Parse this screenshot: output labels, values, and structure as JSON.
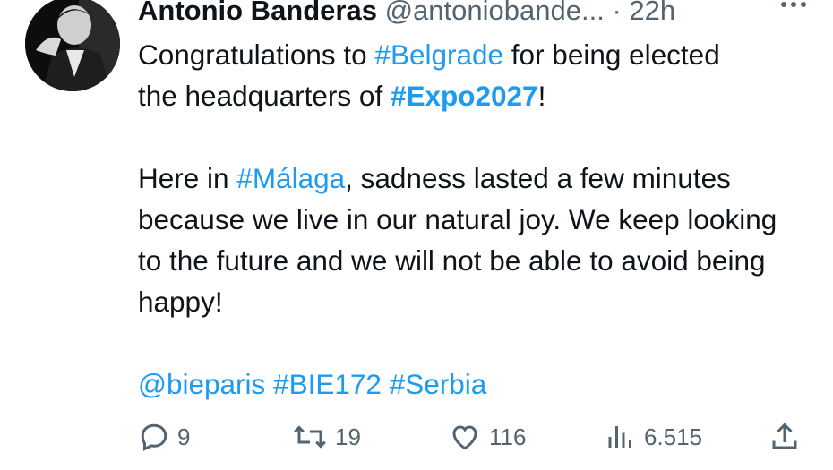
{
  "tweet": {
    "author_name": "Antonio Banderas",
    "author_handle": "@antoniobande...",
    "separator": "·",
    "time": "22h",
    "text": {
      "line1_a": "Congratulations to ",
      "tag_belgrade": "#Belgrade",
      "line1_b": " for being elected",
      "line2_a": "the headquarters of ",
      "tag_expo": "#Expo2027",
      "line2_b": "!",
      "para2_a": "Here in ",
      "tag_malaga": "#Málaga",
      "para2_b": ", sadness lasted a few minutes because we live in our natural joy. We keep looking to the future and we will not be able to avoid being happy!",
      "mention_bie": "@bieparis",
      "tag_bie172": "#BIE172",
      "tag_serbia": "#Serbia"
    }
  },
  "actions": {
    "replies": "9",
    "retweets": "19",
    "likes": "116",
    "views": "6.515"
  },
  "icons": {
    "reply": "reply-icon",
    "retweet": "retweet-icon",
    "like": "heart-icon",
    "views": "views-icon",
    "share": "share-icon",
    "more": "more-icon"
  },
  "colors": {
    "link": "#1d9bf0",
    "secondary": "#536471",
    "text": "#0f1419"
  }
}
